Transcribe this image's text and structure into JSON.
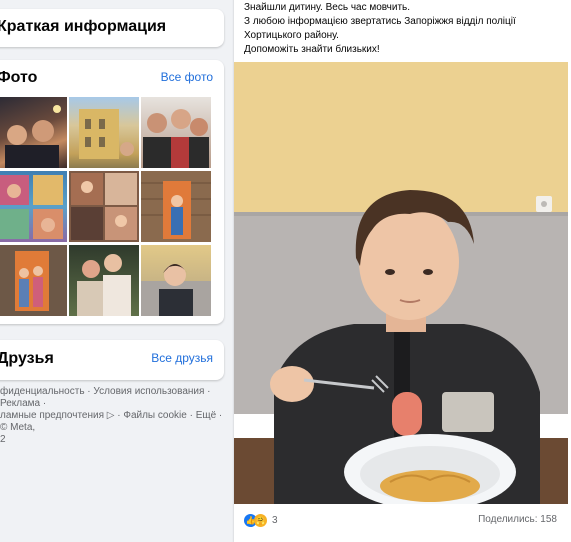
{
  "intro": {
    "title": "Краткая информация"
  },
  "photos": {
    "title": "Фото",
    "see_all": "Все фото",
    "items": [
      {
        "icon": "photo-night-group"
      },
      {
        "icon": "photo-building"
      },
      {
        "icon": "photo-women-group"
      },
      {
        "icon": "photo-collage"
      },
      {
        "icon": "photo-collage-2"
      },
      {
        "icon": "photo-girl-door"
      },
      {
        "icon": "photo-kids-door"
      },
      {
        "icon": "photo-women-2"
      },
      {
        "icon": "photo-boy"
      }
    ]
  },
  "friends": {
    "title": "Друзья",
    "see_all": "Все друзья"
  },
  "footer": {
    "line1": "фиденциальность · Условия использования · Реклама ·",
    "line2": "ламные предпочтения ▷ · Файлы cookie · Ещё · © Meta,",
    "line3": "2"
  },
  "post": {
    "lines": [
      "Знайшли дитину. Весь час мовчить.",
      "З любою інформацією звертатись Запоріжжя відділ поліції",
      "Хортицького району.",
      "Допоможіть знайти близьких!"
    ],
    "reaction_count": "3",
    "shares": "Поделились: 158"
  },
  "colors": {
    "link": "#216fdb",
    "like_blue": "#1877f2",
    "reaction_yellow": "#f7b125"
  }
}
